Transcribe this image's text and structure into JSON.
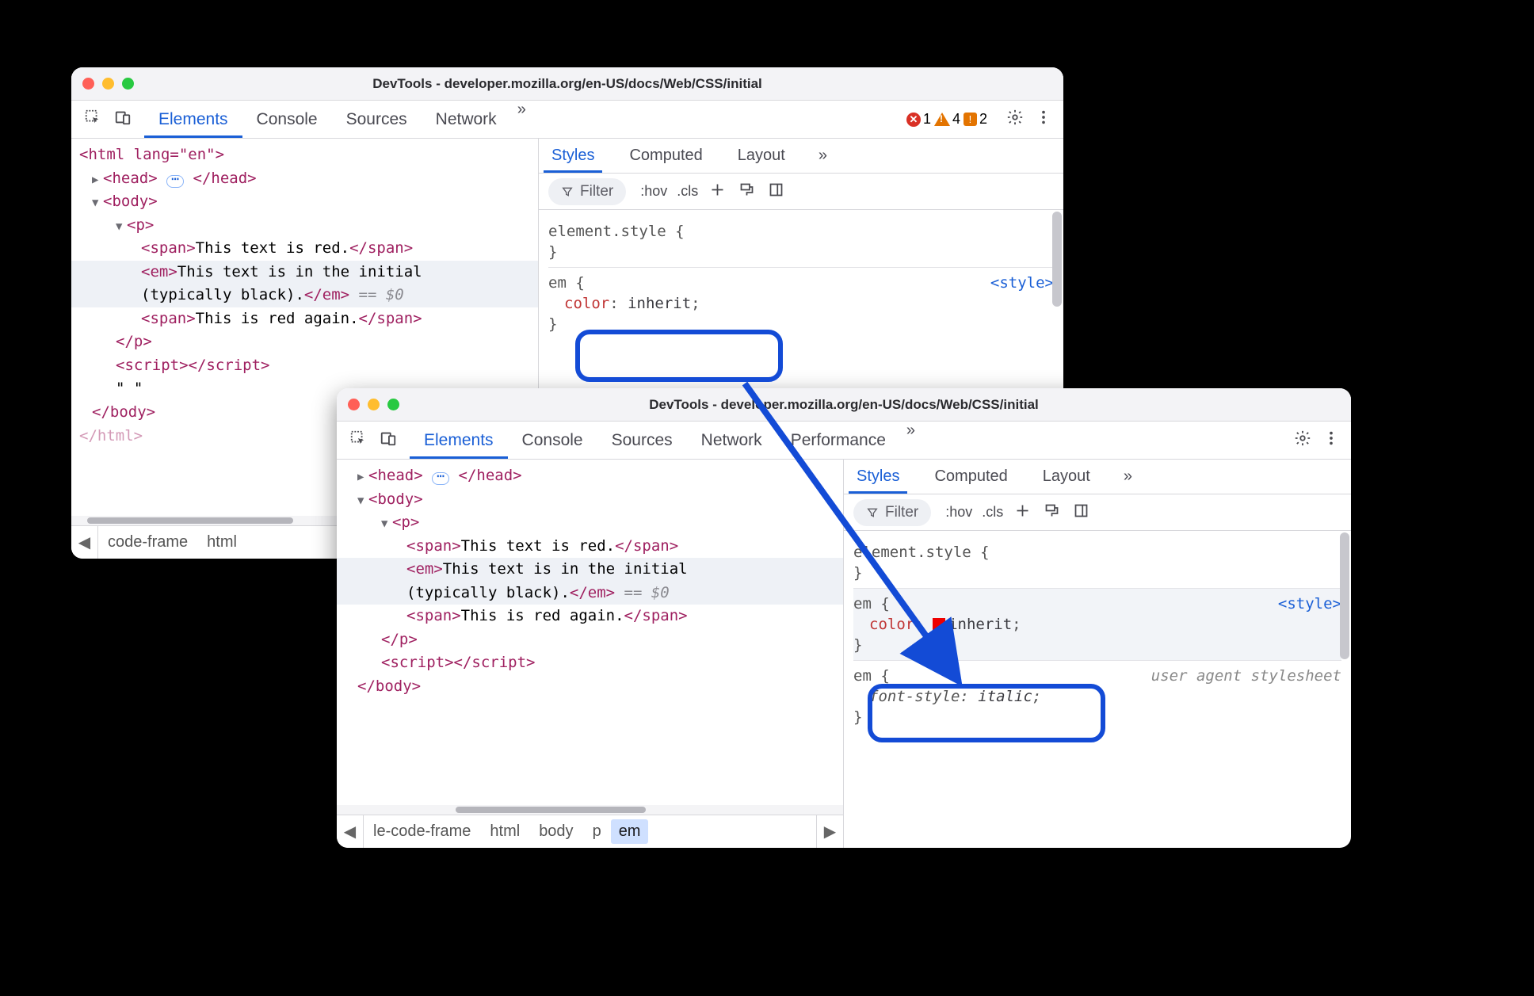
{
  "windows": {
    "back": {
      "title": "DevTools - developer.mozilla.org/en-US/docs/Web/CSS/initial",
      "tabs": [
        "Elements",
        "Console",
        "Sources",
        "Network"
      ],
      "activeTab": "Elements",
      "counters": {
        "errors": "1",
        "warnings": "4",
        "issues": "2"
      },
      "dom": {
        "htmlOpen": "<html lang=\"en\">",
        "headOpen": "<head>",
        "headClose": "</head>",
        "bodyOpen": "<body>",
        "pOpen": "<p>",
        "span1Open": "<span>",
        "span1Text": "This text is red.",
        "span1Close": "</span>",
        "emOpen": "<em>",
        "emText1": "This text is in the initial",
        "emText2": "(typically black).",
        "emClose": "</em>",
        "eq0": " == $0",
        "span2Open": "<span>",
        "span2Text": "This is red again.",
        "span2Close": "</span>",
        "pClose": "</p>",
        "scriptOpen": "<script>",
        "scriptClose": "</script>",
        "emptyText": "\" \"",
        "bodyClose": "</body>",
        "htmlClose": "</html>"
      },
      "breadcrumb": [
        "code-frame",
        "html"
      ],
      "styles": {
        "tabs": [
          "Styles",
          "Computed",
          "Layout"
        ],
        "active": "Styles",
        "filterPlaceholder": "Filter",
        "hov": ":hov",
        "cls": ".cls",
        "elementStyle": "element.style {",
        "brace": "}",
        "emSel": "em {",
        "colorProp": "color",
        "colorVal": "inherit",
        "origin": "<style>"
      }
    },
    "front": {
      "title": "DevTools - developer.mozilla.org/en-US/docs/Web/CSS/initial",
      "tabs": [
        "Elements",
        "Console",
        "Sources",
        "Network",
        "Performance"
      ],
      "activeTab": "Elements",
      "dom": {
        "headOpen": "<head>",
        "headClose": "</head>",
        "bodyOpen": "<body>",
        "pOpen": "<p>",
        "span1Open": "<span>",
        "span1Text": "This text is red.",
        "span1Close": "</span>",
        "emOpen": "<em>",
        "emText1": "This text is in the initial",
        "emText2": "(typically black).",
        "emClose": "</em>",
        "eq0": " == $0",
        "span2Open": "<span>",
        "span2Text": "This is red again.",
        "span2Close": "</span>",
        "pClose": "</p>",
        "scriptOpen": "<script>",
        "scriptClose": "</script>",
        "bodyClose": "</body>"
      },
      "breadcrumb": [
        "le-code-frame",
        "html",
        "body",
        "p",
        "em"
      ],
      "breadcrumbSel": "em",
      "styles": {
        "tabs": [
          "Styles",
          "Computed",
          "Layout"
        ],
        "active": "Styles",
        "filterPlaceholder": "Filter",
        "hov": ":hov",
        "cls": ".cls",
        "elementStyle": "element.style {",
        "brace": "}",
        "emSel": "em {",
        "colorProp": "color",
        "colorVal": "inherit",
        "origin": "<style>",
        "uaSel": "em {",
        "uaProp": "font-style",
        "uaVal": "italic",
        "uaOrigin": "user agent stylesheet"
      }
    }
  }
}
